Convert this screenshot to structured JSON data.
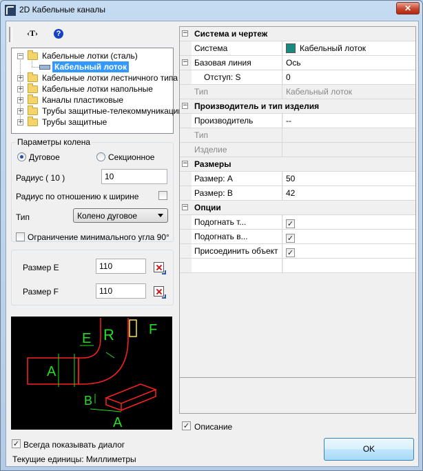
{
  "window": {
    "title": "2D Кабельные каналы",
    "close_label": "✕"
  },
  "toolbar": {
    "text_tool": "‹T›",
    "help": "?"
  },
  "tree": {
    "items": [
      {
        "label": "Кабельные лотки (сталь)",
        "expander": "−"
      },
      {
        "label": "Кабельный лоток",
        "selected": true
      },
      {
        "label": "Кабельные лотки лестничного типа",
        "expander": "+"
      },
      {
        "label": "Кабельные лотки напольные",
        "expander": "+"
      },
      {
        "label": "Каналы пластиковые",
        "expander": "+"
      },
      {
        "label": "Трубы защитные-телекоммуникации",
        "expander": "+"
      },
      {
        "label": "Трубы защитные",
        "expander": "+"
      }
    ]
  },
  "elbow": {
    "group_title": "Параметры колена",
    "radio_arc": "Дуговое",
    "radio_section": "Секционное",
    "radius_label": "Радиус ( 10 )",
    "radius_value": "10",
    "radius_ratio_label": "Радиус по отношению к ширине",
    "type_label": "Тип",
    "type_value": "Колено дуговое",
    "min_angle_label": "Ограничение минимального угла 90°"
  },
  "sizes": {
    "e_label": "Размер E",
    "e_value": "110",
    "f_label": "Размер F",
    "f_value": "110"
  },
  "preview_labels": {
    "E": "E",
    "R": "R",
    "F": "F",
    "A": "A",
    "B": "B",
    "A2": "A"
  },
  "props": {
    "cat_system": "Система и чертеж",
    "system_name": "Система",
    "system_value": "Кабельный лоток",
    "system_color": "#1a8a7f",
    "baseline_name": "Базовая линия",
    "baseline_value": "Ось",
    "offset_name": "Отступ: S",
    "offset_value": "0",
    "type_name": "Тип",
    "type_value": "Кабельный лоток",
    "cat_maker": "Производитель и тип изделия",
    "maker_name": "Производитель",
    "maker_value": "--",
    "maker_type_name": "Тип",
    "product_name": "Изделие",
    "cat_sizes": "Размеры",
    "size_a_name": "Размер: A",
    "size_a_value": "50",
    "size_b_name": "Размер: B",
    "size_b_value": "42",
    "cat_options": "Опции",
    "fit1_name": "Подогнать т...",
    "fit2_name": "Подогнать в...",
    "attach_name": "Присоединить объект",
    "check": "✓"
  },
  "bottom": {
    "description_label": "Описание",
    "always_show_label": "Всегда показывать диалог",
    "units_label": "Текущие единицы: Миллиметры",
    "ok_label": "OK"
  }
}
